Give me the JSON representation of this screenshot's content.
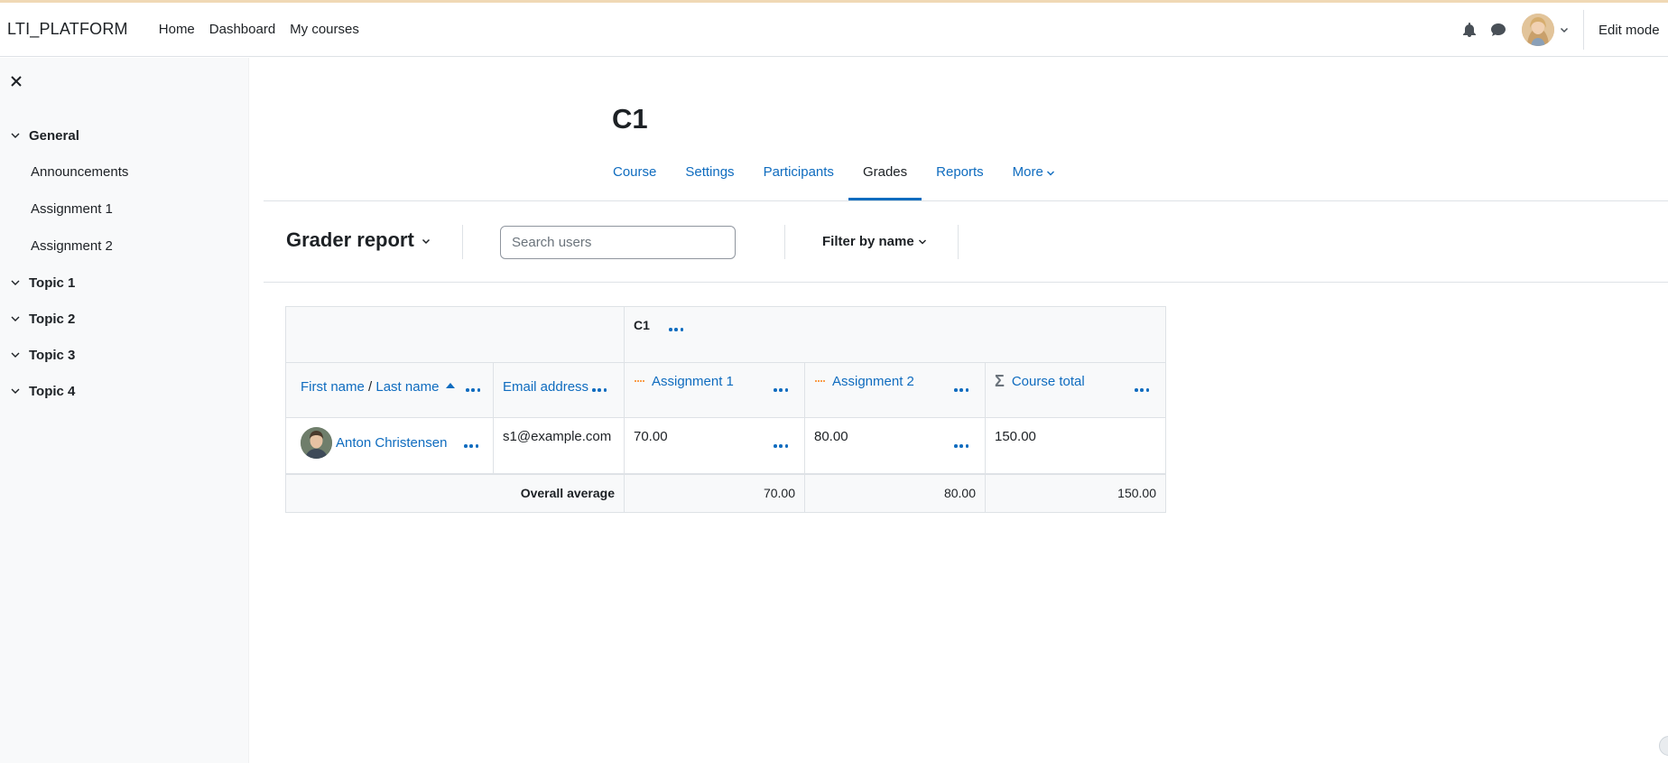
{
  "brand": "LTI_PLATFORM",
  "primary_nav": [
    "Home",
    "Dashboard",
    "My courses"
  ],
  "edit_mode_label": "Edit mode",
  "icons": {
    "notifications": "bell-icon",
    "messages": "chat-bubble-icon",
    "close_drawer": "close-icon",
    "chevron": "chevron-down-icon",
    "sigma": "sigma-icon",
    "actions": "ellipsis-icon"
  },
  "drawer": {
    "sections": [
      {
        "label": "General",
        "items": [
          "Announcements",
          "Assignment 1",
          "Assignment 2"
        ]
      },
      {
        "label": "Topic 1",
        "items": []
      },
      {
        "label": "Topic 2",
        "items": []
      },
      {
        "label": "Topic 3",
        "items": []
      },
      {
        "label": "Topic 4",
        "items": []
      }
    ]
  },
  "course": {
    "title": "C1"
  },
  "secondary_nav": [
    {
      "label": "Course",
      "active": false
    },
    {
      "label": "Settings",
      "active": false
    },
    {
      "label": "Participants",
      "active": false
    },
    {
      "label": "Grades",
      "active": true
    },
    {
      "label": "Reports",
      "active": false
    },
    {
      "label": "More",
      "active": false
    }
  ],
  "tertiary": {
    "report_label": "Grader report",
    "search_placeholder": "Search users",
    "filter_label": "Filter by name"
  },
  "table": {
    "category": "C1",
    "headers": {
      "first_name": "First name",
      "separator": " / ",
      "last_name": "Last name",
      "email": "Email address",
      "assignment1": "Assignment 1",
      "assignment2": "Assignment 2",
      "course_total": "Course total"
    },
    "rows": [
      {
        "name": "Anton Christensen",
        "email": "s1@example.com",
        "assignment1": "70.00",
        "assignment2": "80.00",
        "total": "150.00"
      }
    ],
    "average": {
      "label": "Overall average",
      "assignment1": "70.00",
      "assignment2": "80.00",
      "total": "150.00"
    }
  },
  "colors": {
    "link": "#0f6cbf",
    "text": "#1d2125",
    "drawer_bg": "#f8f9fa",
    "accent_bar": "#f0d9b5"
  }
}
